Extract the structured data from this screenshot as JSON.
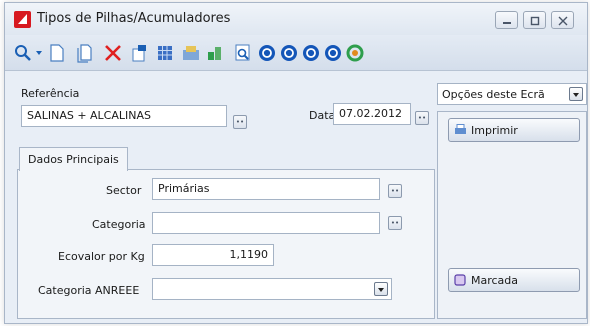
{
  "window": {
    "title": "Tipos de Pilhas/Acumuladores",
    "controls": [
      "minimize-icon",
      "maximize-icon",
      "close-icon"
    ]
  },
  "toolbar": {
    "icons": [
      "search-icon",
      "new-document-icon",
      "copy-document-icon",
      "delete-icon",
      "edit-icon",
      "grid-icon",
      "export-icon",
      "tools-icon",
      "print-preview-icon",
      "first-record-icon",
      "previous-record-icon",
      "next-record-icon",
      "last-record-icon",
      "refresh-icon"
    ]
  },
  "form": {
    "referencia_label": "Referência",
    "referencia_value": "SALINAS + ALCALINAS",
    "data_label": "Data",
    "data_value": "07.02.2012",
    "tab_label": "Dados Principais",
    "sector_label": "Sector",
    "sector_value": "Primárias",
    "categoria_label": "Categoria",
    "categoria_value": "",
    "ecovalor_label": "Ecovalor por Kg",
    "ecovalor_value": "1,1190",
    "categoria_anreee_label": "Categoria ANREEE",
    "categoria_anreee_value": ""
  },
  "side": {
    "options_label": "Opções deste Ecrã",
    "imprimir_label": "Imprimir",
    "marcada_label": "Marcada"
  },
  "colors": {
    "accent": "#1a5fb4",
    "app_icon": "#d71920",
    "panel": "#e8eef6"
  }
}
